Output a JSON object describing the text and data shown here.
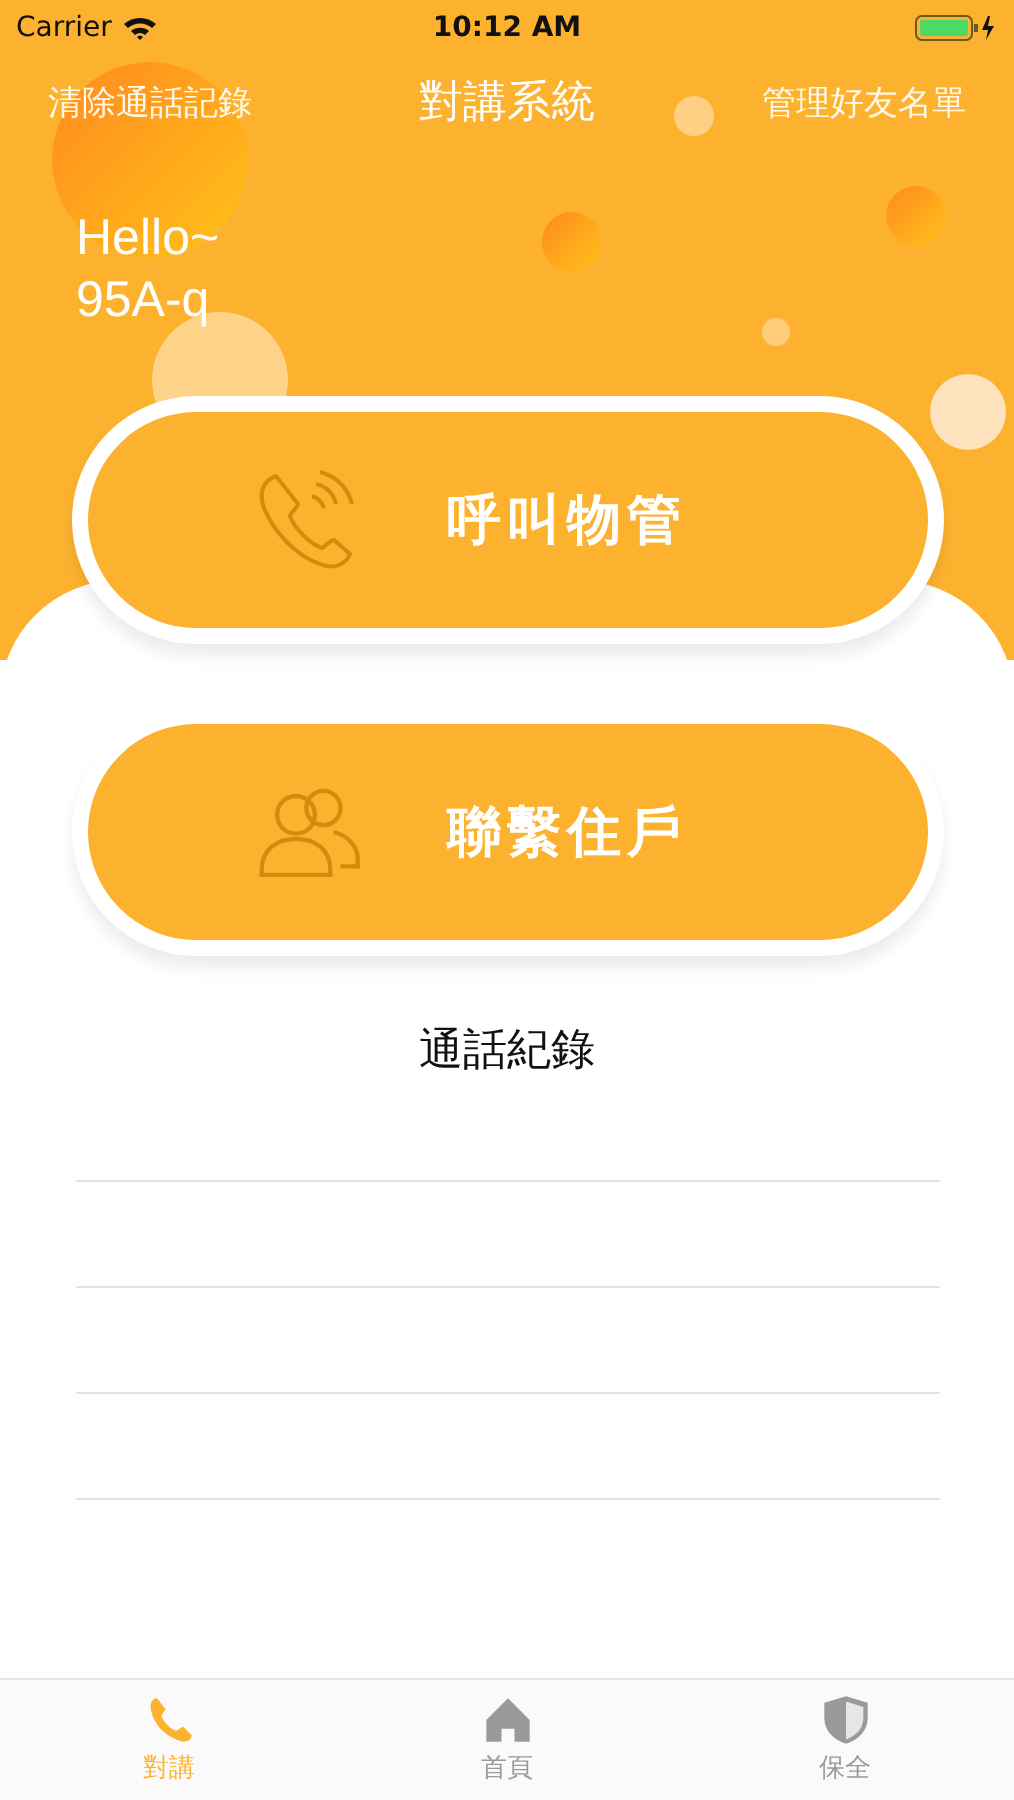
{
  "status_bar": {
    "carrier": "Carrier",
    "time": "10:12 AM"
  },
  "nav": {
    "left": "清除通話記錄",
    "title": "對講系統",
    "right": "管理好友名單"
  },
  "greeting": [
    "Hello~",
    "95A-q"
  ],
  "actions": [
    {
      "kind": "phone",
      "label": "呼叫物管"
    },
    {
      "kind": "people",
      "label": "聯繫住戶"
    }
  ],
  "history": {
    "title": "通話紀錄"
  },
  "tabs": [
    {
      "kind": "phone",
      "label": "對講",
      "selected": true
    },
    {
      "kind": "home",
      "label": "首頁",
      "selected": false
    },
    {
      "kind": "shield",
      "label": "保全",
      "selected": false
    }
  ]
}
